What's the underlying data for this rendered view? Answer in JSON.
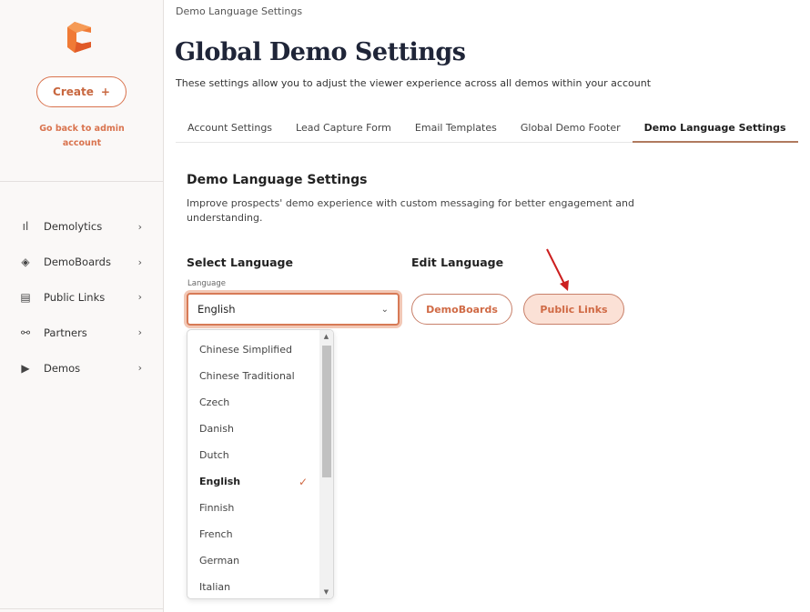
{
  "sidebar": {
    "create_label": "Create",
    "back_label": "Go back to admin account",
    "items": [
      {
        "label": "Demolytics",
        "icon": "bar-chart-icon"
      },
      {
        "label": "DemoBoards",
        "icon": "tag-icon"
      },
      {
        "label": "Public Links",
        "icon": "storefront-icon"
      },
      {
        "label": "Partners",
        "icon": "network-icon"
      },
      {
        "label": "Demos",
        "icon": "play-circle-icon"
      }
    ]
  },
  "header": {
    "breadcrumb": "Demo Language Settings",
    "title": "Global Demo Settings",
    "subtitle": "These settings allow you to adjust the viewer experience across all demos within your account"
  },
  "tabs": [
    {
      "label": "Account Settings"
    },
    {
      "label": "Lead Capture Form"
    },
    {
      "label": "Email Templates"
    },
    {
      "label": "Global Demo Footer"
    },
    {
      "label": "Demo Language Settings",
      "active": true
    }
  ],
  "section": {
    "title": "Demo Language Settings",
    "description": "Improve prospects' demo experience with custom messaging for better engagement and understanding.",
    "select_heading": "Select Language",
    "edit_heading": "Edit Language",
    "field_label": "Language",
    "selected_value": "English",
    "edit_buttons": [
      "DemoBoards",
      "Public Links"
    ]
  },
  "dropdown": {
    "options": [
      "Chinese Simplified",
      "Chinese Traditional",
      "Czech",
      "Danish",
      "Dutch",
      "English",
      "Finnish",
      "French",
      "German",
      "Italian"
    ],
    "selected": "English"
  },
  "colors": {
    "accent": "#d06a45",
    "annotation_arrow": "#cc1f1f"
  }
}
